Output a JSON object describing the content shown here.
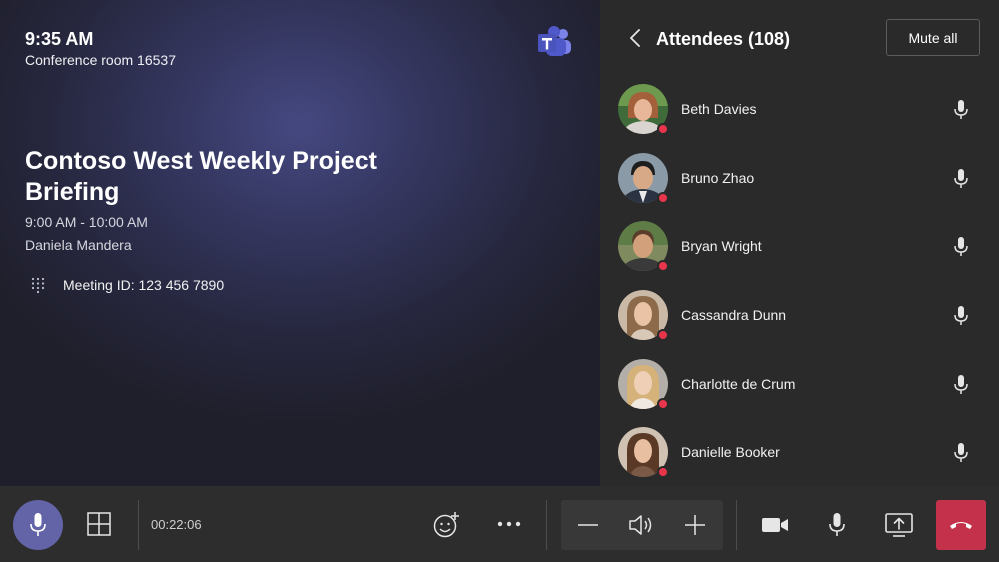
{
  "meeting": {
    "clock": "9:35 AM",
    "room": "Conference room 16537",
    "title": "Contoso West Weekly Project Briefing",
    "time_range": "9:00 AM - 10:00 AM",
    "organizer": "Daniela Mandera",
    "meeting_id": "Meeting ID: 123 456 7890"
  },
  "panel": {
    "title": "Attendees (108)",
    "mute_all_label": "Mute all",
    "attendees": [
      {
        "name": "Beth Davies",
        "status": "busy"
      },
      {
        "name": "Bruno Zhao",
        "status": "busy"
      },
      {
        "name": "Bryan Wright",
        "status": "busy"
      },
      {
        "name": "Cassandra Dunn",
        "status": "busy"
      },
      {
        "name": "Charlotte de Crum",
        "status": "busy"
      },
      {
        "name": "Danielle Booker",
        "status": "busy"
      }
    ]
  },
  "controls": {
    "duration": "00:22:06"
  },
  "icons": {
    "brand": "teams-logo-icon",
    "back": "chevron-left-icon",
    "mic": "microphone-icon",
    "dialpad": "dialpad-icon",
    "layout": "grid-layout-icon",
    "react": "emoji-add-icon",
    "more": "more-options-icon",
    "volume_down": "minus-icon",
    "speaker": "speaker-icon",
    "volume_up": "plus-icon",
    "video": "video-camera-icon",
    "share": "share-screen-icon",
    "hangup": "hang-up-icon"
  },
  "colors": {
    "accent": "#6264a7",
    "presence_busy": "#e8354b",
    "hangup": "#c4314b",
    "panel_bg": "#2a2a2a",
    "bar_bg": "#2d2d2d"
  }
}
